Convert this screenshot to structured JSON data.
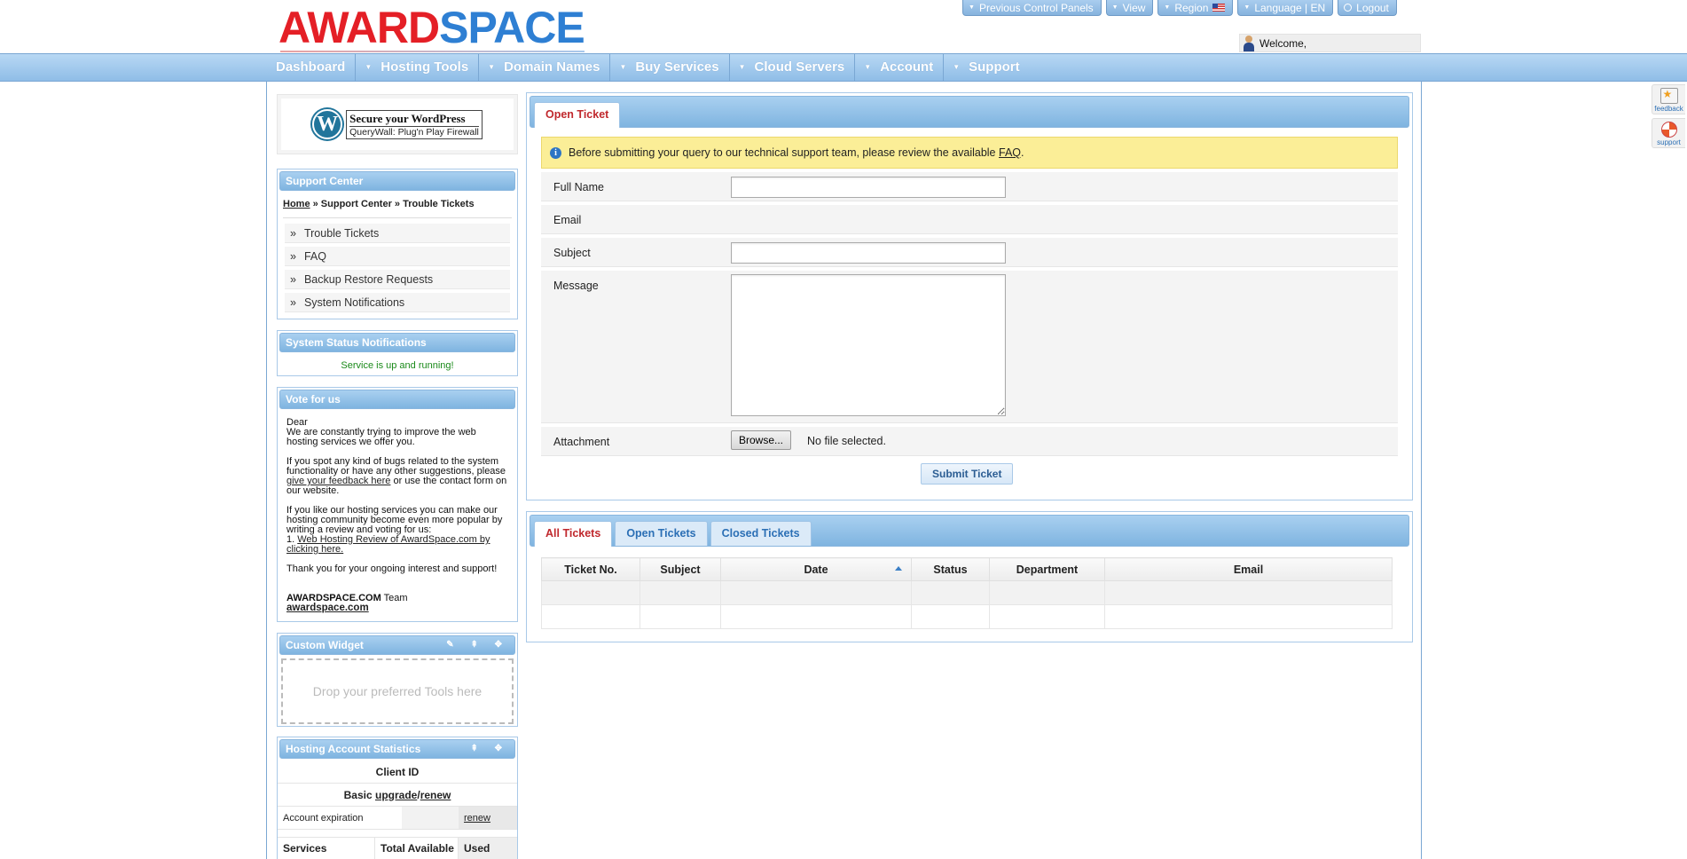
{
  "header": {
    "logo_part1": "AWARD",
    "logo_part2": "SPACE",
    "topbar": [
      {
        "label": "Previous Control Panels"
      },
      {
        "label": "View"
      },
      {
        "label": "Region"
      },
      {
        "label": "Language | EN"
      },
      {
        "label": "Logout"
      }
    ],
    "welcome": "Welcome,"
  },
  "nav": {
    "items": [
      "Dashboard",
      "Hosting Tools",
      "Domain Names",
      "Buy Services",
      "Cloud Servers",
      "Account",
      "Support"
    ]
  },
  "sidebar": {
    "wp_banner": {
      "logo_letter": "W",
      "title": "Secure your WordPress",
      "subtitle": "QueryWall: Plug'n Play Firewall"
    },
    "support_center": {
      "title": "Support Center",
      "breadcrumb_home": "Home",
      "breadcrumb_rest": " » Support Center » Trouble Tickets",
      "links": [
        "Trouble Tickets",
        "FAQ",
        "Backup Restore Requests",
        "System Notifications"
      ],
      "bullet": "»"
    },
    "system_status": {
      "title": "System Status Notifications",
      "message": "Service is up and running!"
    },
    "vote": {
      "title": "Vote for us",
      "dear": "Dear",
      "p1": "We are constantly trying to improve the web hosting services we offer you.",
      "p2_a": "If you spot any kind of bugs related to the system functionality or have any other suggestions, please ",
      "p2_link": "give your feedback here",
      "p2_b": " or use the contact form on our website.",
      "p3": "If you like our hosting services you can make our hosting community become even more popular by writing a review and voting for us:",
      "p3_num": "1. ",
      "p3_link": "Web Hosting Review of AwardSpace.com by clicking here.",
      "p4": "Thank you for your ongoing interest and support!",
      "sig_bold": "AWARDSPACE.COM",
      "sig_rest": " Team",
      "sig_link": "awardspace.com"
    },
    "custom_widget": {
      "title": "Custom Widget",
      "tools": "✎ ⇞ ✥",
      "dropzone": "Drop your preferred Tools here"
    },
    "stats": {
      "title": "Hosting Account Statistics",
      "tools": "⇞ ✥",
      "client_id": "Client ID",
      "plan": "Basic ",
      "upgrade": "upgrade",
      "slash": "/",
      "renew": "renew",
      "expiration_label": "Account expiration",
      "expiration_link": "renew",
      "headers": [
        "Services",
        "Total Available",
        "Used"
      ]
    }
  },
  "ticket_form": {
    "tab": "Open Ticket",
    "notice_text": "Before submitting your query to our technical support team, please review the available ",
    "notice_link": "FAQ",
    "notice_end": ".",
    "info_glyph": "i",
    "fields": {
      "full_name": "Full Name",
      "email": "Email",
      "subject": "Subject",
      "message": "Message",
      "attachment": "Attachment"
    },
    "browse": "Browse...",
    "no_file": "No file selected.",
    "submit": "Submit Ticket"
  },
  "ticket_list": {
    "tabs": [
      "All Tickets",
      "Open Tickets",
      "Closed Tickets"
    ],
    "columns": [
      "Ticket No.",
      "Subject",
      "Date",
      "Status",
      "Department",
      "Email"
    ]
  },
  "side_tabs": {
    "feedback": "feedback",
    "support": "support"
  },
  "colors": {
    "brand_red": "#e41f26",
    "brand_blue": "#2e7fd3",
    "nav_blue": "#8fbde7",
    "active_tab_red": "#c0282d",
    "status_green": "#1a8a1a",
    "notice_yellow": "#fbee97"
  }
}
